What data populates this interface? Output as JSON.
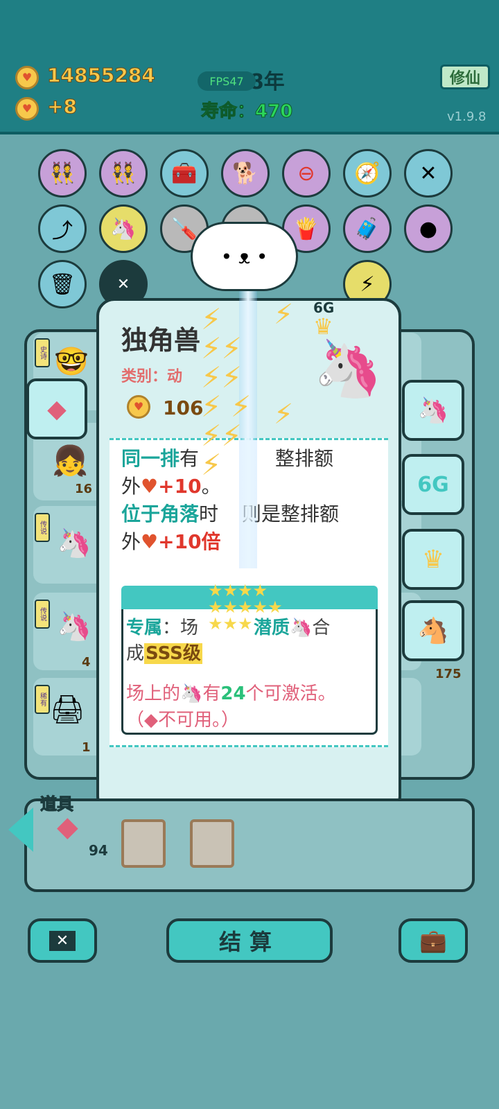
{
  "header": {
    "coins": "14855284",
    "coin_rate": "+8",
    "fps": "FPS47",
    "year": "108年",
    "lifespan_label": "寿命：470",
    "xiuxian_button": "修仙",
    "version": "v1.9.8"
  },
  "item_popup": {
    "name": "独角兽",
    "tag_6g": "6G",
    "category": "类别：动",
    "price": "106",
    "desc_line1_a": "同一排",
    "desc_line1_b": "有",
    "desc_line1_c": "整排额",
    "desc_line2_a": "外",
    "desc_line2_b": "+10",
    "desc_line2_c": "。",
    "desc_line3_a": "位于角落",
    "desc_line3_b": "时",
    "desc_line3_c": "则是整排额",
    "desc_line4_a": "外",
    "desc_line4_b": "+10倍",
    "exclusive_label": "专属",
    "exclusive_a": "：场",
    "exclusive_b": "潜质",
    "exclusive_c": "合",
    "exclusive_d": "成",
    "exclusive_e": "SSS级",
    "activate_a": "场上的",
    "activate_b": "有",
    "activate_c": "24",
    "activate_d": "个可激活。",
    "unavailable_a": "（",
    "unavailable_b": "不可用。）"
  },
  "board": {
    "row_counts": [
      "16",
      "4",
      "1"
    ],
    "side_count": "175",
    "side_tag": "6G"
  },
  "tools": {
    "label": "道具",
    "liver_count": "94"
  },
  "buttons": {
    "settle": "结算"
  },
  "rarity_labels": [
    "史诗",
    "传说",
    "传说",
    "稀有"
  ],
  "colors": {
    "header_bg": "#1f7f84",
    "coin_yellow": "#f7c84b",
    "life_green": "#2bd65a",
    "teal_accent": "#43c7c1"
  }
}
